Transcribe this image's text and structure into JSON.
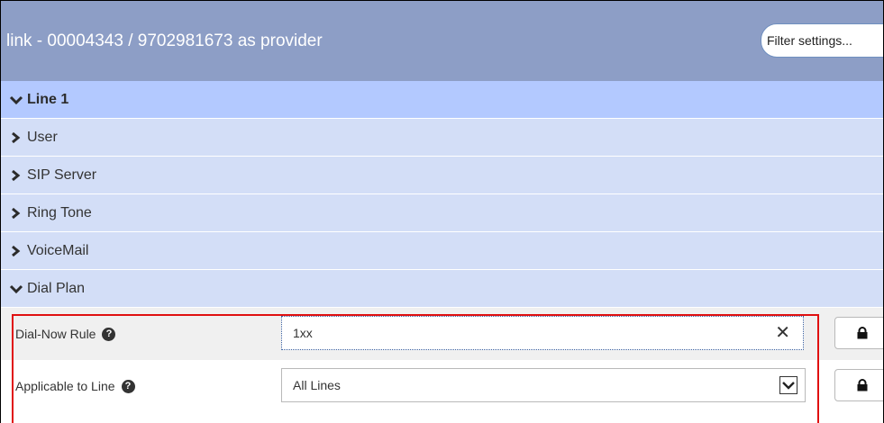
{
  "header": {
    "title": "link - 00004343 / 9702981673 as provider",
    "filter_placeholder": "Filter settings..."
  },
  "sections": {
    "line1": "Line 1",
    "user": "User",
    "sip_server": "SIP Server",
    "ring_tone": "Ring Tone",
    "voicemail": "VoiceMail",
    "dial_plan": "Dial Plan"
  },
  "settings": {
    "dial_now_rule": {
      "label": "Dial-Now Rule",
      "value": "1xx"
    },
    "applicable_to_line": {
      "label": "Applicable to Line",
      "value": "All Lines"
    }
  },
  "icons": {
    "chevron_down": "chevron-down-icon",
    "chevron_right": "chevron-right-icon",
    "help": "help-icon",
    "lock": "lock-icon",
    "clear": "clear-icon",
    "dropdown": "dropdown-arrow-icon"
  },
  "colors": {
    "header_bg": "#8d9ec6",
    "section_main_bg": "#b3c9ff",
    "section_sub_bg": "#d3def7",
    "highlight_border": "#e01010"
  }
}
